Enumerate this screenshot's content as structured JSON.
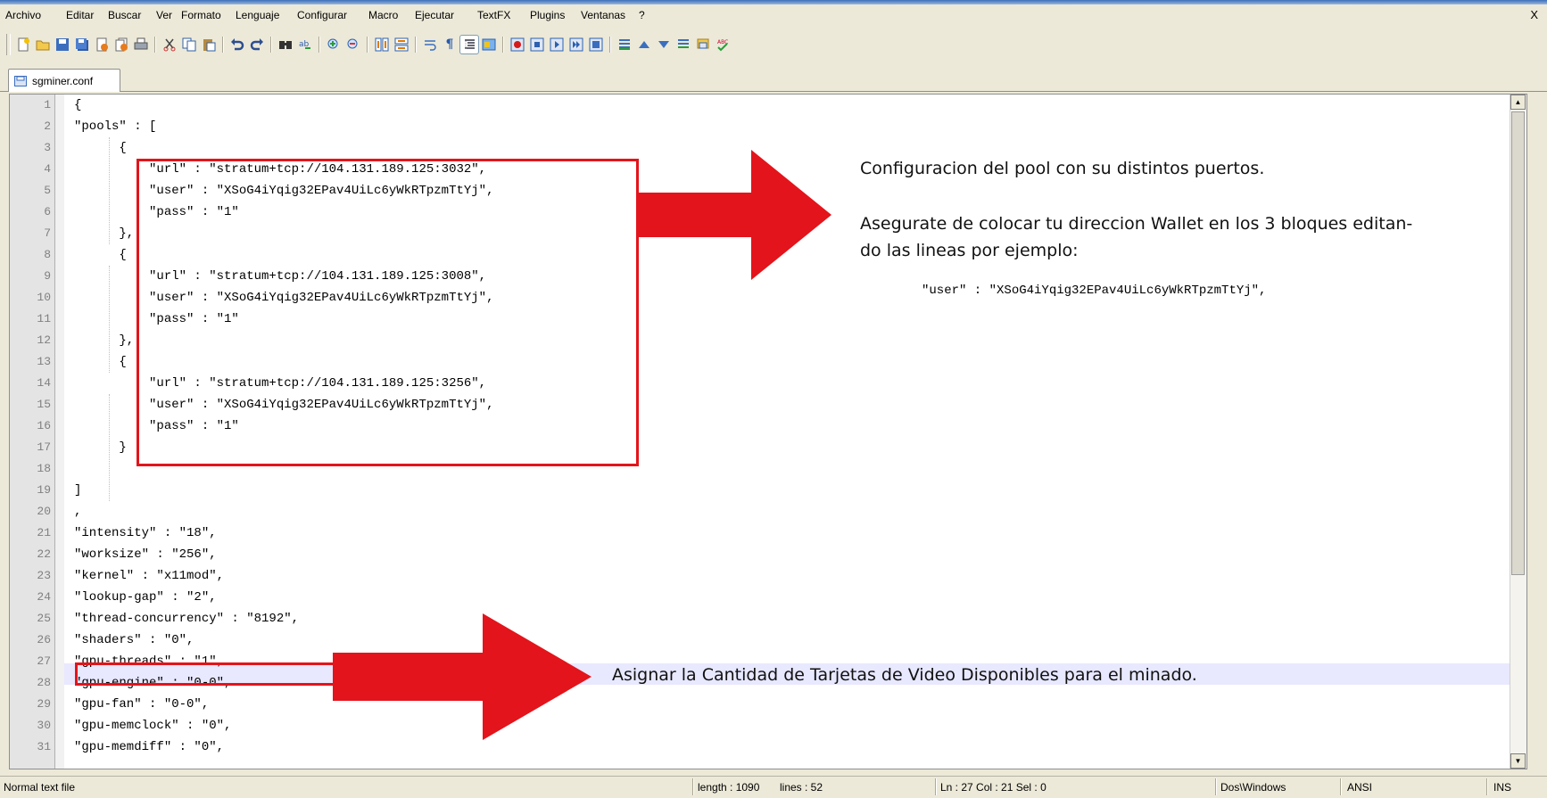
{
  "menu": {
    "items": [
      "Archivo",
      "Editar",
      "Buscar",
      "Ver",
      "Formato",
      "Lenguaje",
      "Configurar",
      "Macro",
      "Ejecutar",
      "TextFX",
      "Plugins",
      "Ventanas",
      "?"
    ],
    "close": "X"
  },
  "toolbar": {
    "buttons": [
      "new",
      "open",
      "save",
      "save-all",
      "close",
      "close-all",
      "print",
      "cut",
      "copy",
      "paste",
      "undo",
      "redo",
      "find",
      "replace",
      "zoom-in",
      "zoom-out",
      "sync-vertical",
      "sync-horizontal",
      "word-wrap",
      "show-all-chars",
      "indent-guide",
      "user-language",
      "record-macro",
      "stop-recording",
      "play-macro",
      "run-macro-multiple",
      "save-macro",
      "bookmark-toggle",
      "bookmark-up",
      "bookmark-down",
      "clear-bookmarks",
      "document-map",
      "spell-check"
    ]
  },
  "tab": {
    "label": "sgminer.conf"
  },
  "editor": {
    "lines": [
      "{",
      "\"pools\" : [",
      "      {",
      "          \"url\" : \"stratum+tcp://104.131.189.125:3032\",",
      "          \"user\" : \"XSoG4iYqig32EPav4UiLc6yWkRTpzmTtYj\",",
      "          \"pass\" : \"1\"",
      "      },",
      "      {",
      "          \"url\" : \"stratum+tcp://104.131.189.125:3008\",",
      "          \"user\" : \"XSoG4iYqig32EPav4UiLc6yWkRTpzmTtYj\",",
      "          \"pass\" : \"1\"",
      "      },",
      "      {",
      "          \"url\" : \"stratum+tcp://104.131.189.125:3256\",",
      "          \"user\" : \"XSoG4iYqig32EPav4UiLc6yWkRTpzmTtYj\",",
      "          \"pass\" : \"1\"",
      "      }",
      "",
      "]",
      ",",
      "\"intensity\" : \"18\",",
      "\"worksize\" : \"256\",",
      "\"kernel\" : \"x11mod\",",
      "\"lookup-gap\" : \"2\",",
      "\"thread-concurrency\" : \"8192\",",
      "\"shaders\" : \"0\",",
      "\"gpu-threads\" : \"1\",",
      "\"gpu-engine\" : \"0-0\",",
      "\"gpu-fan\" : \"0-0\",",
      "\"gpu-memclock\" : \"0\",",
      "\"gpu-memdiff\" : \"0\","
    ],
    "current_line": 27
  },
  "annotations": {
    "pool_title": "Configuracion del pool con su distintos puertos.",
    "wallet_line1": "Asegurate de colocar tu direccion Wallet en los 3 bloques  editan-",
    "wallet_line2": "do las lineas por ejemplo:",
    "wallet_example": "\"user\" : \"XSoG4iYqig32EPav4UiLc6yWkRTpzmTtYj\",",
    "gpu_note": "Asignar la Cantidad de Tarjetas de Video Disponibles para el minado.",
    "color": "#e3141b"
  },
  "status": {
    "type": "Normal text file",
    "length": "length : 1090",
    "lines": "lines : 52",
    "position": "Ln : 27   Col : 21   Sel : 0",
    "eol": "Dos\\Windows",
    "encoding": "ANSI",
    "mode": "INS"
  }
}
